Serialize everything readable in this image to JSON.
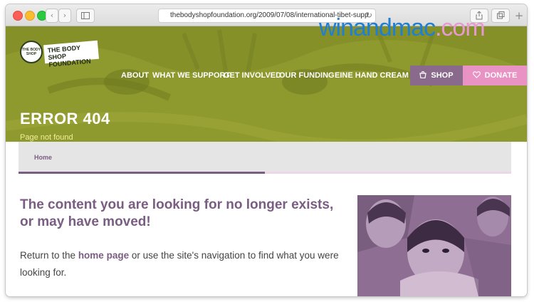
{
  "browser": {
    "url": "thebodyshopfoundation.org/2009/07/08/international-tibet-supp",
    "nav_back": "‹",
    "nav_forward": "›",
    "sidebar_icon": "sidebar-icon",
    "reload_icon": "↻",
    "share_icon": "share-icon",
    "tabs_icon": "tabs-icon",
    "new_tab_label": "+"
  },
  "watermark": {
    "part1": "winandmac",
    "part2": ".com"
  },
  "logo": {
    "circle_text": "THE BODY SHOP",
    "plate_text": "THE BODY SHOP FOUNDATION"
  },
  "nav": {
    "items": [
      "ABOUT",
      "WHAT WE SUPPORT",
      "GET INVOLVED",
      "OUR FUNDING",
      "EINE HAND CREAM"
    ],
    "shop_label": "SHOP",
    "donate_label": "DONATE"
  },
  "hero": {
    "title": "ERROR 404",
    "subtitle": "Page not found"
  },
  "breadcrumb": {
    "home": "Home",
    "progress_fraction": 0.5
  },
  "content": {
    "heading": "The content you are looking for no longer exists, or may have moved!",
    "body_before": "Return to the ",
    "body_link": "home page",
    "body_after": " or use the site's navigation to find what you were looking for."
  },
  "colors": {
    "hero_olive": "#8f9a2e",
    "brand_purple": "#7a5d82",
    "shop_purple": "#8a6a8c",
    "donate_pink": "#e992c4",
    "watermark_blue": "#1f7fd2",
    "watermark_pink": "#e89ad0"
  }
}
